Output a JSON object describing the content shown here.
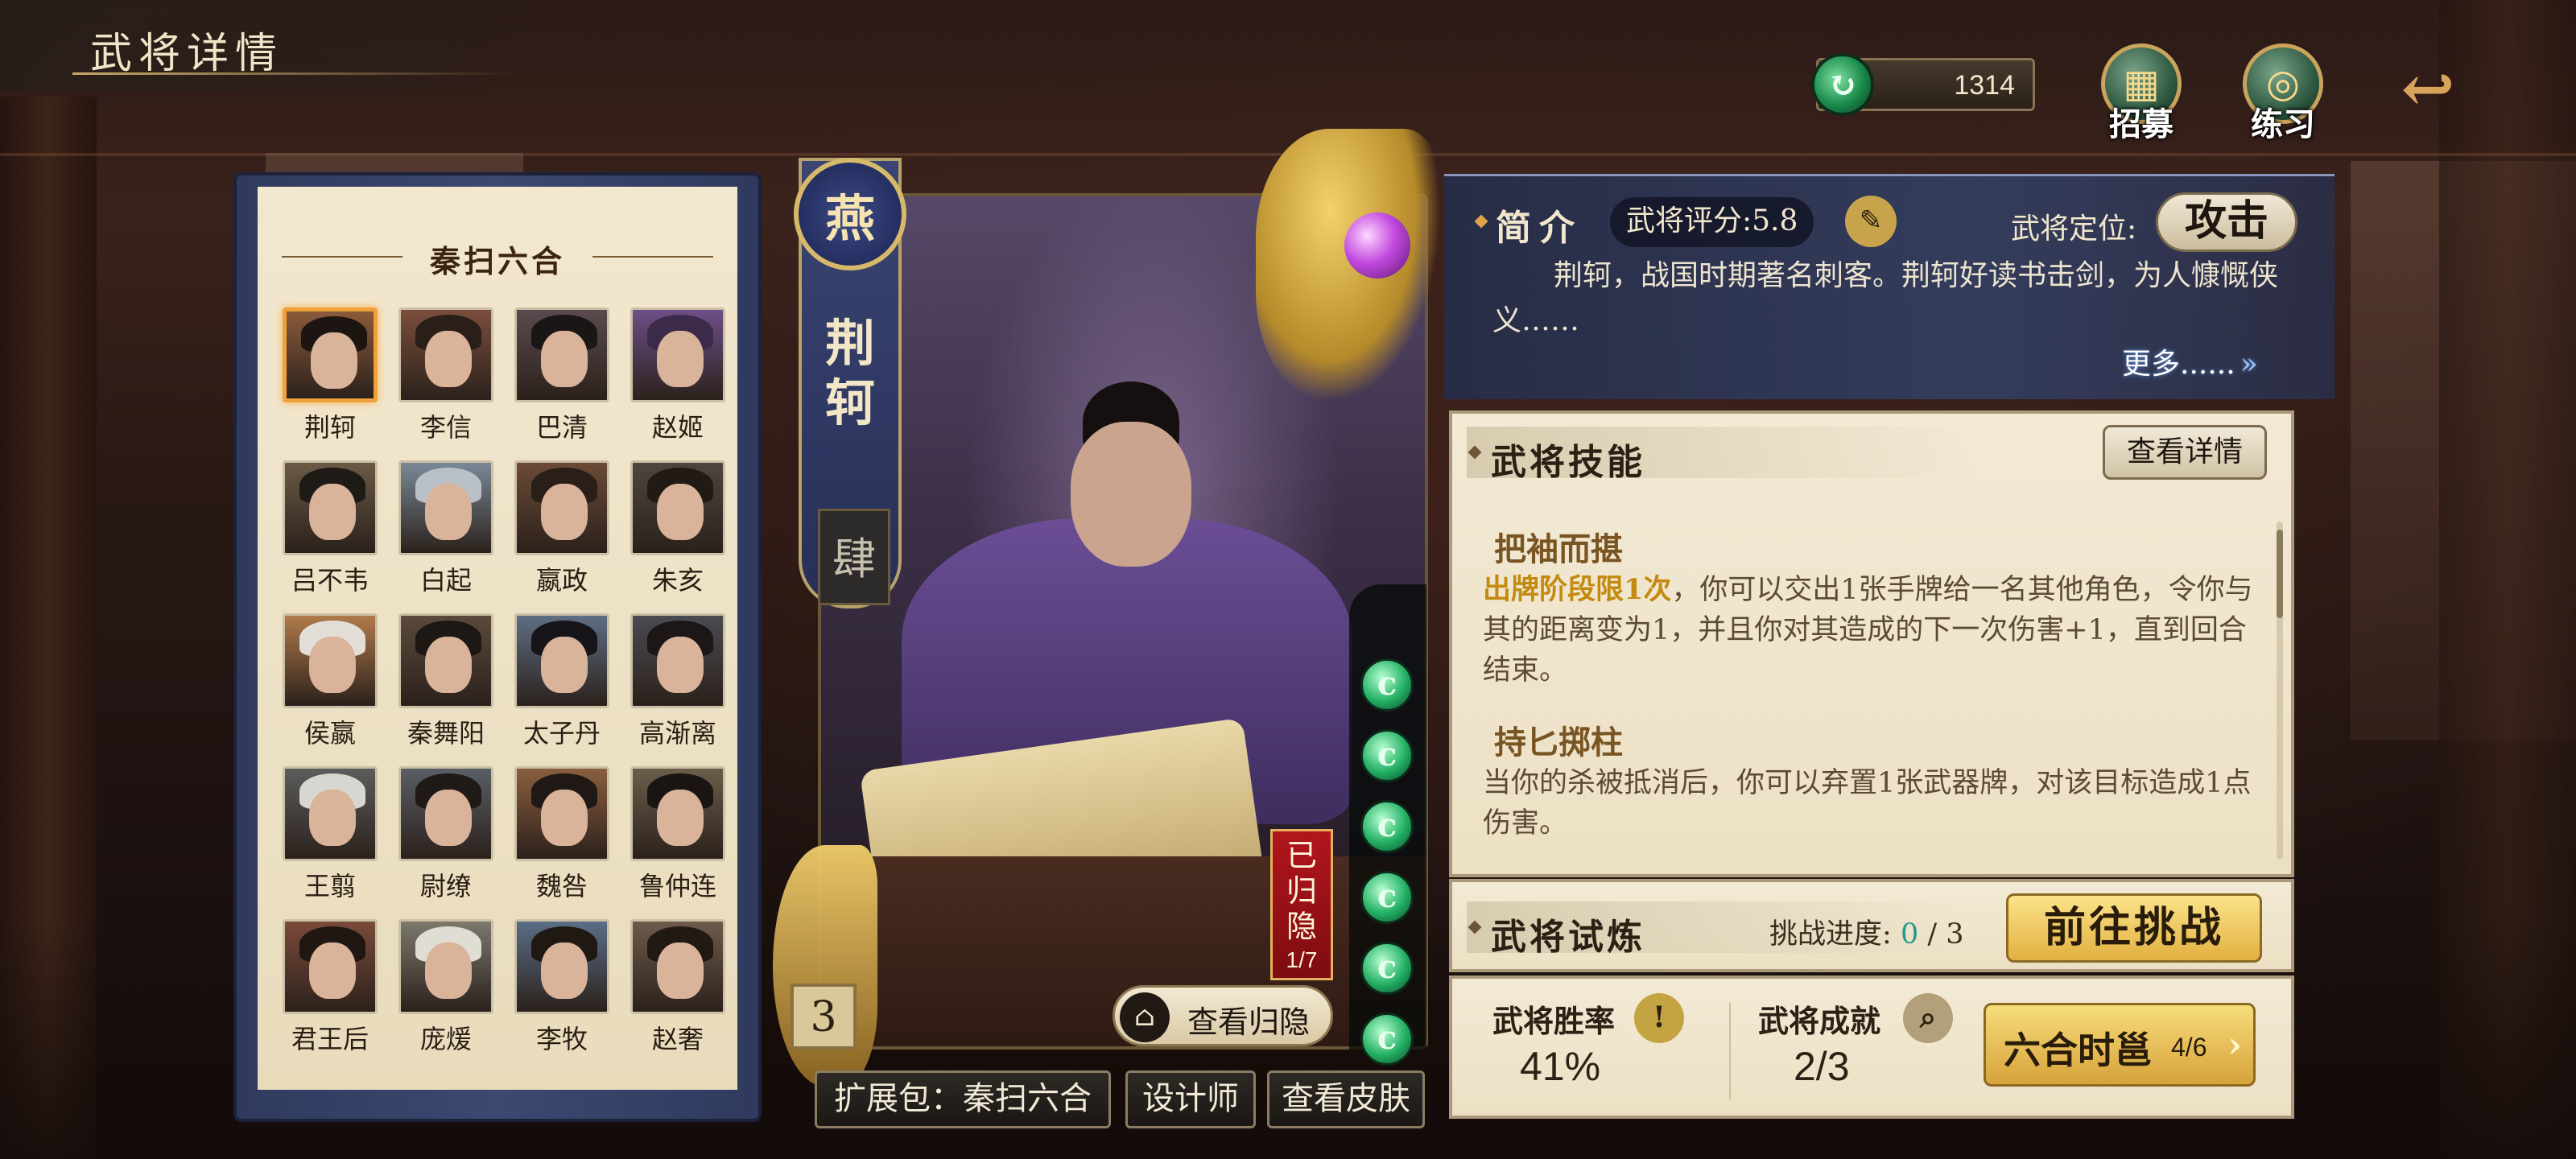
{
  "header": {
    "title": "武将详情"
  },
  "hud": {
    "currency_value": "1314",
    "currency_icon": "jade-coin-icon",
    "recruit_label": "招募",
    "practice_label": "练习",
    "back_icon": "back-arrow-icon"
  },
  "roster": {
    "title": "秦扫六合",
    "heroes": [
      {
        "name": "荆轲",
        "selected": true
      },
      {
        "name": "李信"
      },
      {
        "name": "巴清"
      },
      {
        "name": "赵姬"
      },
      {
        "name": "吕不韦"
      },
      {
        "name": "白起"
      },
      {
        "name": "嬴政"
      },
      {
        "name": "朱亥"
      },
      {
        "name": "侯嬴"
      },
      {
        "name": "秦舞阳"
      },
      {
        "name": "太子丹"
      },
      {
        "name": "高渐离"
      },
      {
        "name": "王翦"
      },
      {
        "name": "尉缭"
      },
      {
        "name": "魏咎"
      },
      {
        "name": "鲁仲连"
      },
      {
        "name": "君王后"
      },
      {
        "name": "庞煖"
      },
      {
        "name": "李牧"
      },
      {
        "name": "赵奢"
      }
    ]
  },
  "card": {
    "faction": "燕",
    "name": "荆轲",
    "rank": "肆",
    "level": "3",
    "hidden_tag": "已归隐",
    "hidden_count": "1/7",
    "view_return": "查看归隐",
    "gem_count": 6
  },
  "card_buttons": {
    "expansion": "扩展包：秦扫六合",
    "designer": "设计师",
    "skins": "查看皮肤"
  },
  "intro": {
    "label": "简介",
    "score_text": "武将评分:5.8",
    "position_label": "武将定位:",
    "position_value": "攻击",
    "text": "荆轲，战国时期著名刺客。荆轲好读书击剑，为人慷慨侠义……",
    "more": "更多......",
    "more_icon": "double-chevron-right-icon"
  },
  "skills": {
    "title": "武将技能",
    "detail_button": "查看详情",
    "items": [
      {
        "name": "把袖而揕",
        "highlight": "出牌阶段限1次",
        "text": "，你可以交出1张手牌给一名其他角色，令你与其的距离变为1，并且你对其造成的下一次伤害+1，直到回合结束。"
      },
      {
        "name": "持匕掷柱",
        "highlight": "",
        "text": "当你的杀被抵消后，你可以弃置1张武器牌，对该目标造成1点伤害。"
      }
    ]
  },
  "trial": {
    "title": "武将试炼",
    "progress_label": "挑战进度:",
    "progress_current": "0",
    "progress_total": "/ 3",
    "go_button": "前往挑战"
  },
  "stats": {
    "win_rate_label": "武将胜率",
    "win_rate_value": "41%",
    "achievement_label": "武将成就",
    "achievement_value": "2/3",
    "liuhe_label": "六合时邕",
    "liuhe_count": "4/6"
  },
  "colors": {
    "accent_gold": "#e2b040",
    "panel_paper": "#f3ead5",
    "intro_blue": "#343e60",
    "highlight_text": "#c48a10"
  }
}
